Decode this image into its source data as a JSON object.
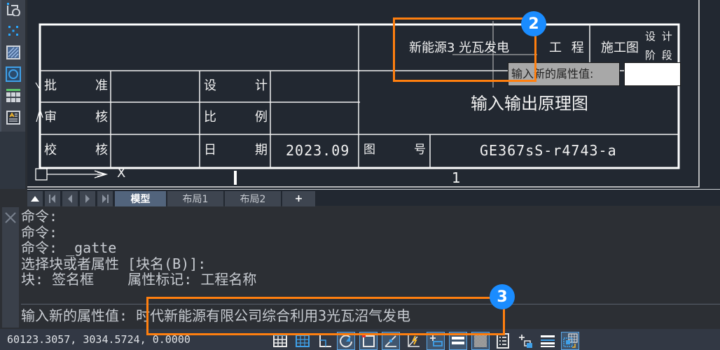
{
  "palette": {
    "tools": [
      {
        "name": "boundary-icon"
      },
      {
        "name": "point-grid-icon"
      },
      {
        "name": "hatch-icon"
      },
      {
        "name": "region-icon"
      },
      {
        "name": "table-icon"
      },
      {
        "name": "attribute-block-icon"
      }
    ]
  },
  "drawing": {
    "title_block": {
      "project_name": "新能源3 光瓦发电",
      "project_label": "工 程",
      "design_stage_value": "施工图",
      "design_stage_label_1": "设 计",
      "design_stage_label_2": "阶 段",
      "drawing_title": "输入输出原理图",
      "rows": [
        {
          "label_left": "批",
          "label_right": "准"
        },
        {
          "label_left": "审",
          "label_right": "核"
        },
        {
          "label_left": "校",
          "label_right": "核"
        }
      ],
      "mid_rows": [
        {
          "label_left": "设",
          "label_right": "计",
          "value": ""
        },
        {
          "label_left": "比",
          "label_right": "例",
          "value": ""
        },
        {
          "label_left": "日",
          "label_right": "期",
          "value": "2023.09"
        }
      ],
      "drawing_no_label_left": "图",
      "drawing_no_label_right": "号",
      "drawing_no": "GE367sS-r4743-a"
    },
    "page_number": "1",
    "ucs_x_label": "X",
    "attr_editor": {
      "prompt": "输入新的属性值:",
      "value": ""
    }
  },
  "tabs": {
    "nav": [
      "▲",
      "first",
      "prev",
      "next",
      "last"
    ],
    "items": [
      {
        "label": "模型",
        "active": true
      },
      {
        "label": "布局1",
        "active": false
      },
      {
        "label": "布局2",
        "active": false
      }
    ],
    "add_label": "+"
  },
  "command": {
    "history": [
      "命令:",
      "命令:",
      "命令: _gatte",
      "选择块或者属性 [块名(B)]:",
      "块: 签名框    属性标记: 工程名称"
    ],
    "prompt": "输入新的属性值: ",
    "input_value": "时代新能源有限公司综合利用3光瓦沼气发电"
  },
  "status": {
    "coords": "60123.3057,  3034.5724,  0.0000",
    "buttons": [
      {
        "name": "grid-icon",
        "on": false
      },
      {
        "name": "snap-icon",
        "on": false
      },
      {
        "name": "ortho-icon",
        "on": false
      },
      {
        "name": "polar-icon",
        "on": true
      },
      {
        "name": "osnap-icon",
        "on": true
      },
      {
        "name": "otrack-icon",
        "on": true
      },
      {
        "name": "dynamic-ucs-icon",
        "on": false
      },
      {
        "name": "dynamic-input-icon",
        "on": true
      },
      {
        "name": "lineweight-icon",
        "on": true
      },
      {
        "name": "transparency-icon",
        "on": true
      },
      {
        "name": "quick-properties-icon",
        "on": false
      },
      {
        "name": "selection-cycling-icon",
        "on": false
      },
      {
        "name": "annotation-monitor-icon",
        "on": false
      },
      {
        "name": "workspace-icon",
        "on": true
      }
    ]
  },
  "annotations": [
    {
      "number": "2",
      "color": "#ff7f0f",
      "badge_color": "#1a8cff"
    },
    {
      "number": "3",
      "color": "#ff7f0f",
      "badge_color": "#1a8cff"
    }
  ]
}
